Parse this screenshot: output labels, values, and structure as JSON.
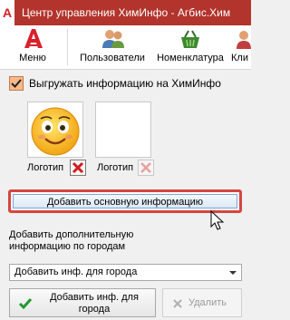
{
  "window": {
    "title": "Центр управления ХимИнфо - Агбис.Хим",
    "app_icon_letter": "A",
    "accent_color": "#b2342c"
  },
  "toolbar": {
    "menu_label": "Меню",
    "users_label": "Пользователи",
    "nomenclature_label": "Номенклатура",
    "clients_label": "Кли"
  },
  "export_checkbox": {
    "label": "Выгружать информацию на ХимИнфо",
    "checked": true
  },
  "logos": [
    {
      "label": "Логотип",
      "has_image": true,
      "delete_enabled": true
    },
    {
      "label": "Логотип",
      "has_image": false,
      "delete_enabled": false
    }
  ],
  "add_main_info_button": "Добавить основную информацию",
  "city_info_description": "Добавить дополнительную информацию по городам",
  "city_select": {
    "value": "Добавить инф. для города"
  },
  "add_city_button": "Добавить инф. для города",
  "remove_button": "Удалить"
}
